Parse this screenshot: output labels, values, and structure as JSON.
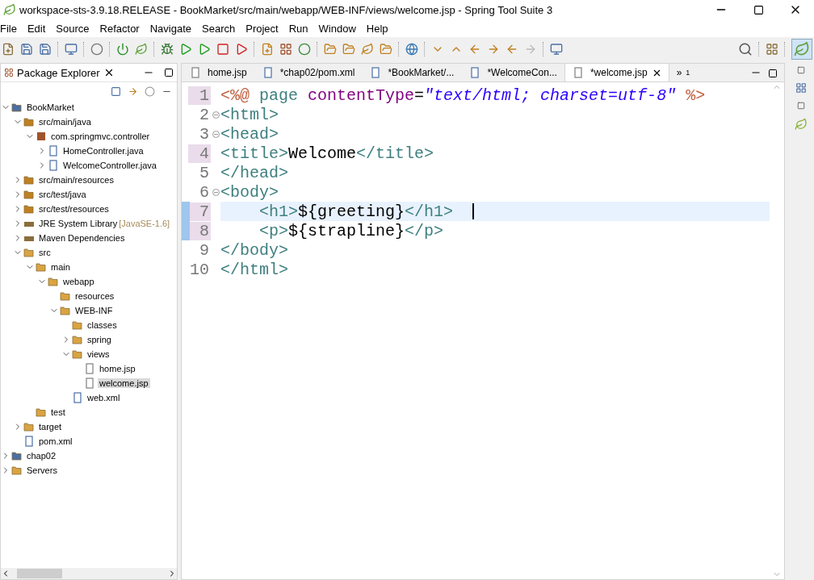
{
  "window": {
    "title": "workspace-sts-3.9.18.RELEASE - BookMarket/src/main/webapp/WEB-INF/views/welcome.jsp - Spring Tool Suite 3"
  },
  "menu": [
    "File",
    "Edit",
    "Source",
    "Refactor",
    "Navigate",
    "Search",
    "Project",
    "Run",
    "Window",
    "Help"
  ],
  "explorer": {
    "title": "Package Explorer",
    "tree": [
      {
        "label": "BookMarket",
        "kind": "project",
        "expanded": true,
        "selected": false,
        "children": [
          {
            "label": "src/main/java",
            "kind": "srcfolder",
            "expanded": true,
            "selected": false,
            "children": [
              {
                "label": "com.springmvc.controller",
                "kind": "package",
                "expanded": true,
                "selected": false,
                "children": [
                  {
                    "label": "HomeController.java",
                    "kind": "java",
                    "expanded": false,
                    "selected": false
                  },
                  {
                    "label": "WelcomeController.java",
                    "kind": "java",
                    "expanded": false,
                    "selected": false
                  }
                ]
              }
            ]
          },
          {
            "label": "src/main/resources",
            "kind": "srcfolder",
            "expanded": false,
            "selected": false
          },
          {
            "label": "src/test/java",
            "kind": "srcfolder",
            "expanded": false,
            "selected": false
          },
          {
            "label": "src/test/resources",
            "kind": "srcfolder",
            "expanded": false,
            "selected": false
          },
          {
            "label": "JRE System Library",
            "decoration": "[JavaSE-1.6]",
            "kind": "library",
            "expanded": false,
            "selected": false
          },
          {
            "label": "Maven Dependencies",
            "kind": "library",
            "expanded": false,
            "selected": false
          },
          {
            "label": "src",
            "kind": "folder",
            "expanded": true,
            "selected": false,
            "children": [
              {
                "label": "main",
                "kind": "folder",
                "expanded": true,
                "selected": false,
                "children": [
                  {
                    "label": "webapp",
                    "kind": "folder",
                    "expanded": true,
                    "selected": false,
                    "children": [
                      {
                        "label": "resources",
                        "kind": "folder",
                        "selected": false
                      },
                      {
                        "label": "WEB-INF",
                        "kind": "folder",
                        "expanded": true,
                        "selected": false,
                        "children": [
                          {
                            "label": "classes",
                            "kind": "folder",
                            "selected": false
                          },
                          {
                            "label": "spring",
                            "kind": "folder",
                            "expanded": false,
                            "selected": false
                          },
                          {
                            "label": "views",
                            "kind": "folder",
                            "expanded": true,
                            "selected": false,
                            "children": [
                              {
                                "label": "home.jsp",
                                "kind": "jsp",
                                "selected": false
                              },
                              {
                                "label": "welcome.jsp",
                                "kind": "jsp",
                                "selected": true
                              }
                            ]
                          },
                          {
                            "label": "web.xml",
                            "kind": "xml",
                            "selected": false
                          }
                        ]
                      }
                    ]
                  }
                ]
              },
              {
                "label": "test",
                "kind": "folder",
                "selected": false
              }
            ]
          },
          {
            "label": "target",
            "kind": "folder",
            "expanded": false,
            "selected": false
          },
          {
            "label": "pom.xml",
            "kind": "pom",
            "selected": false
          }
        ]
      },
      {
        "label": "chap02",
        "kind": "project",
        "expanded": false,
        "selected": false
      },
      {
        "label": "Servers",
        "kind": "folder",
        "expanded": false,
        "selected": false
      }
    ]
  },
  "tabs": [
    {
      "label": "home.jsp",
      "kind": "jsp",
      "selected": false
    },
    {
      "label": "*chap02/pom.xml",
      "kind": "pom",
      "selected": false
    },
    {
      "label": "*BookMarket/...",
      "kind": "pom",
      "selected": false
    },
    {
      "label": "*WelcomeCon...",
      "kind": "java",
      "selected": false
    },
    {
      "label": "*welcome.jsp",
      "kind": "jsp",
      "selected": true
    }
  ],
  "overflow": {
    "label": "»",
    "count": "1"
  },
  "editor": {
    "lines": [
      {
        "number": "1",
        "changed": true,
        "modified": false,
        "fold": false,
        "current": false,
        "indented": false,
        "tokens": [
          {
            "text": "<%@",
            "kind": "directive"
          },
          {
            "text": " page ",
            "kind": "tag"
          },
          {
            "text": "contentType",
            "kind": "attr"
          },
          {
            "text": "=",
            "kind": "plain"
          },
          {
            "text": "\"text/html; charset=utf-8\"",
            "kind": "string"
          },
          {
            "text": " %>",
            "kind": "directive"
          }
        ]
      },
      {
        "number": "2",
        "changed": false,
        "modified": false,
        "fold": true,
        "current": false,
        "indented": false,
        "tokens": [
          {
            "text": "<html>",
            "kind": "tag"
          }
        ]
      },
      {
        "number": "3",
        "changed": false,
        "modified": false,
        "fold": true,
        "current": false,
        "indented": false,
        "tokens": [
          {
            "text": "<head>",
            "kind": "tag"
          }
        ]
      },
      {
        "number": "4",
        "changed": true,
        "modified": false,
        "fold": false,
        "current": false,
        "indented": false,
        "tokens": [
          {
            "text": "<title>",
            "kind": "tag"
          },
          {
            "text": "Welcome",
            "kind": "plain"
          },
          {
            "text": "</title>",
            "kind": "tag"
          }
        ]
      },
      {
        "number": "5",
        "changed": false,
        "modified": false,
        "fold": false,
        "current": false,
        "indented": false,
        "tokens": [
          {
            "text": "</head>",
            "kind": "tag"
          }
        ]
      },
      {
        "number": "6",
        "changed": false,
        "modified": false,
        "fold": true,
        "current": false,
        "indented": false,
        "tokens": [
          {
            "text": "<body>",
            "kind": "tag"
          }
        ]
      },
      {
        "number": "7",
        "changed": true,
        "modified": true,
        "fold": false,
        "current": true,
        "indented": true,
        "tokens": [
          {
            "text": "<h1>",
            "kind": "tag"
          },
          {
            "text": "${greeting}",
            "kind": "plain"
          },
          {
            "text": "</h1>",
            "kind": "tag"
          }
        ]
      },
      {
        "number": "8",
        "changed": true,
        "modified": true,
        "fold": false,
        "current": false,
        "indented": true,
        "tokens": [
          {
            "text": "<p>",
            "kind": "tag"
          },
          {
            "text": "${strapline}",
            "kind": "plain"
          },
          {
            "text": "</p>",
            "kind": "tag"
          }
        ]
      },
      {
        "number": "9",
        "changed": false,
        "modified": false,
        "fold": false,
        "current": false,
        "indented": false,
        "tokens": [
          {
            "text": "</body>",
            "kind": "tag"
          }
        ]
      },
      {
        "number": "10",
        "changed": false,
        "modified": false,
        "fold": false,
        "current": false,
        "indented": false,
        "tokens": [
          {
            "text": "</html>",
            "kind": "tag"
          }
        ]
      }
    ]
  }
}
